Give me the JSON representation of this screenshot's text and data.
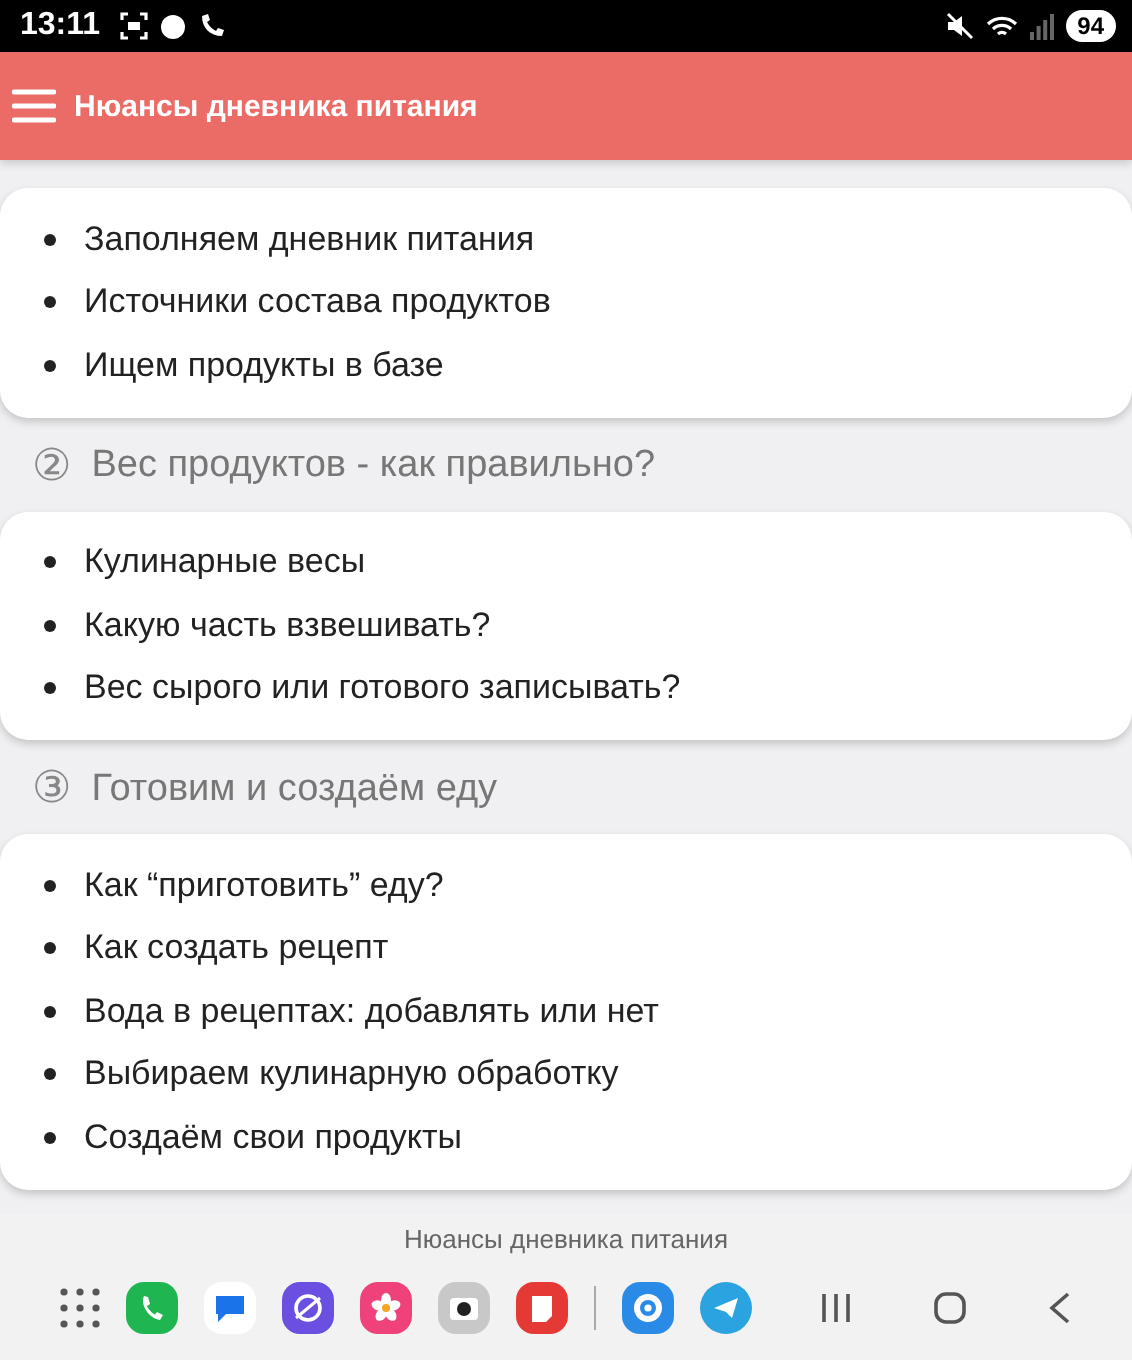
{
  "status_bar": {
    "time": "13:11",
    "battery": "94"
  },
  "header": {
    "title": "Нюансы дневника питания"
  },
  "sections": [
    {
      "items": [
        "Заполняем дневник питания",
        "Источники состава продуктов",
        "Ищем продукты в базе"
      ]
    },
    {
      "number": "②",
      "title": "Вес продуктов - как правильно?",
      "items": [
        "Кулинарные весы",
        "Какую часть взвешивать?",
        "Вес сырого или готового записывать?"
      ]
    },
    {
      "number": "③",
      "title": "Готовим и создаём еду",
      "items": [
        "Как “приготовить” еду?",
        "Как создать рецепт",
        "Вода в рецептах: добавлять или нет",
        "Выбираем кулинарную обработку",
        "Создаём свои продукты"
      ]
    }
  ],
  "taskbar": {
    "app_label": "Нюансы дневника питания"
  }
}
